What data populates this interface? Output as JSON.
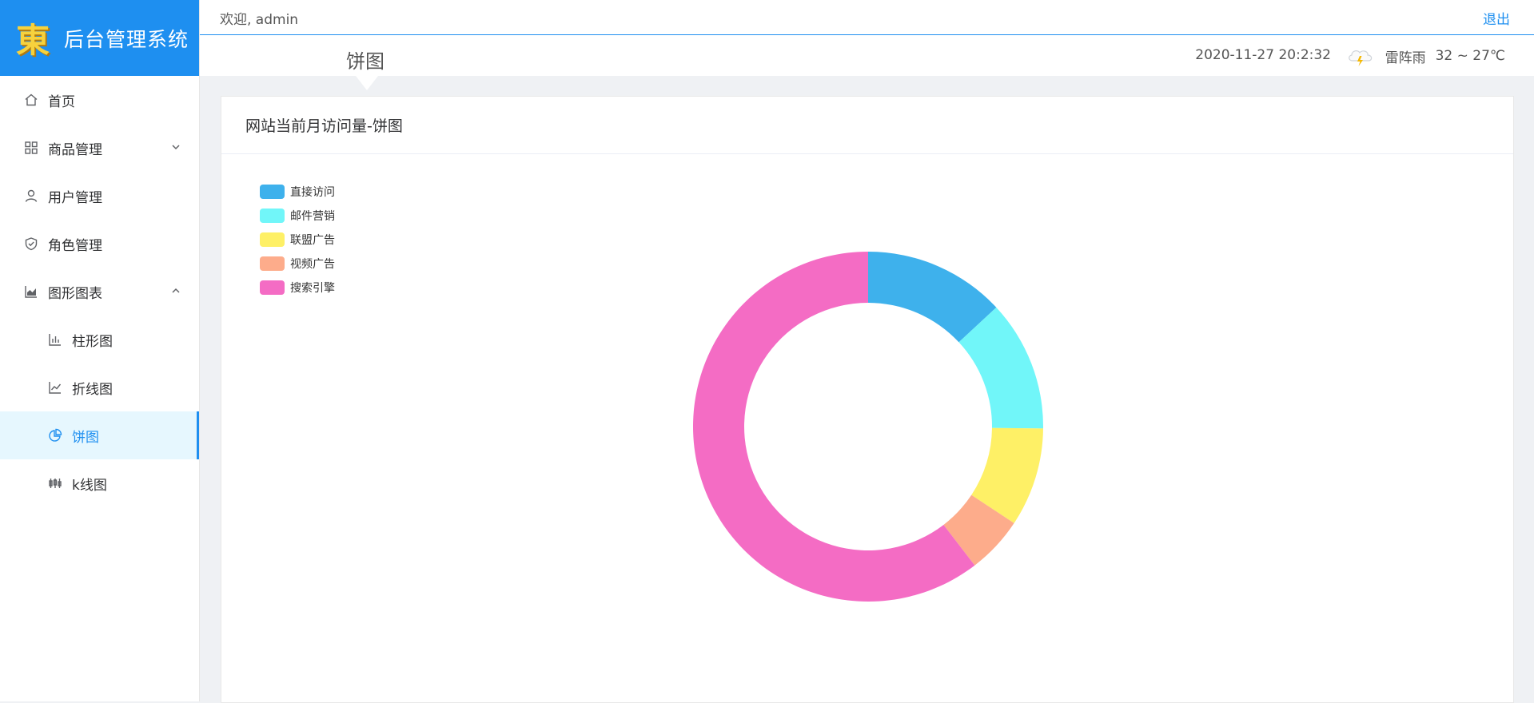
{
  "app": {
    "title": "后台管理系统",
    "logo_char": "東"
  },
  "header": {
    "welcome": "欢迎, admin",
    "logout": "退出"
  },
  "subheader": {
    "page_title": "饼图",
    "datetime": "2020-11-27 20:2:32",
    "weather": {
      "icon": "thunderstorm-icon",
      "condition": "雷阵雨",
      "temp": "32 ~ 27℃"
    }
  },
  "sidebar": {
    "items": [
      {
        "label": "首页",
        "icon": "home-icon"
      },
      {
        "label": "商品管理",
        "icon": "grid-icon",
        "expandable": true,
        "expanded": false
      },
      {
        "label": "用户管理",
        "icon": "user-icon"
      },
      {
        "label": "角色管理",
        "icon": "shield-icon"
      },
      {
        "label": "图形图表",
        "icon": "area-chart-icon",
        "expandable": true,
        "expanded": true
      },
      {
        "label": "柱形图",
        "icon": "bar-chart-icon",
        "sub": true
      },
      {
        "label": "折线图",
        "icon": "line-chart-icon",
        "sub": true
      },
      {
        "label": "饼图",
        "icon": "pie-chart-icon",
        "sub": true,
        "active": true
      },
      {
        "label": "k线图",
        "icon": "candlestick-icon",
        "sub": true
      }
    ]
  },
  "card": {
    "title": "网站当前月访问量-饼图"
  },
  "colors": {
    "accent": "#1e8ff0",
    "active_bg": "#e6f7fe"
  },
  "chart_data": {
    "type": "pie",
    "donut": true,
    "legend_position": "top-left",
    "categories": [
      "直接访问",
      "邮件营销",
      "联盟广告",
      "视频广告",
      "搜索引擎"
    ],
    "values": [
      335,
      310,
      234,
      135,
      1548
    ],
    "colors": [
      "#3eb1ec",
      "#71f6f9",
      "#fef066",
      "#fdac8b",
      "#f46cc4"
    ]
  }
}
